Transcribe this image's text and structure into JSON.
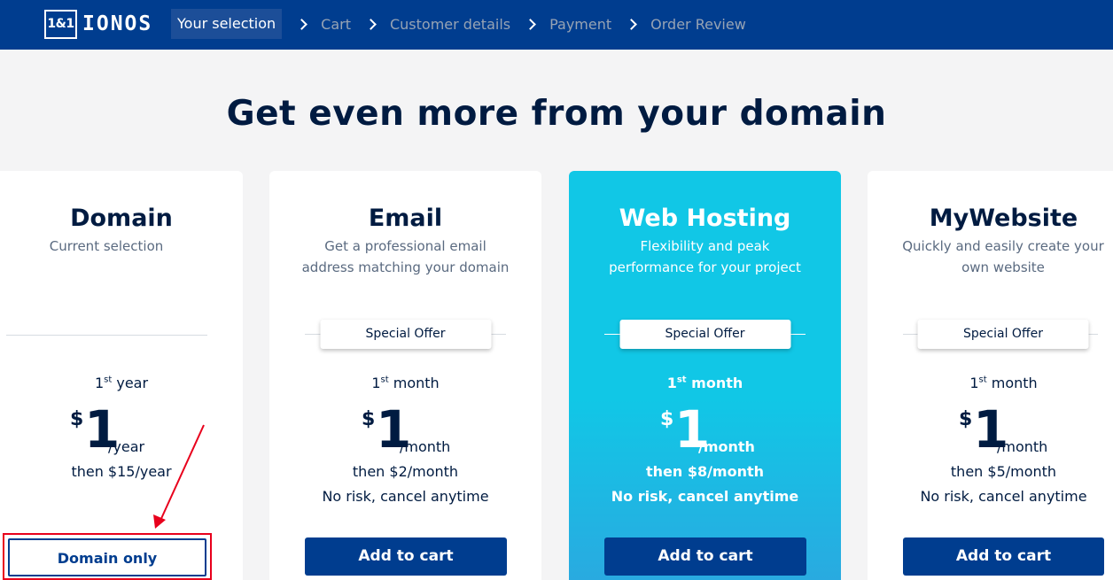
{
  "header": {
    "logo_box": "1&1",
    "logo_word": "IONOS",
    "steps": [
      "Your selection",
      "Cart",
      "Customer details",
      "Payment",
      "Order Review"
    ]
  },
  "headline": "Get even more from your domain",
  "cards": {
    "domain": {
      "title": "Domain",
      "subtitle": "Current selection",
      "period_prefix": "1",
      "period_sup": "st",
      "period_unit": " year",
      "dollar": "$",
      "price": "1",
      "per": "/year",
      "then": "then $15/year",
      "cta": "Domain only"
    },
    "email": {
      "title": "Email",
      "subtitle": "Get a professional email address matching your domain",
      "offer": "Special Offer",
      "period_prefix": "1",
      "period_sup": "st",
      "period_unit": " month",
      "dollar": "$",
      "price": "1",
      "per": "/month",
      "then": "then $2/month",
      "norisk": "No risk, cancel anytime",
      "cta": "Add to cart"
    },
    "hosting": {
      "title": "Web Hosting",
      "subtitle": "Flexibility and peak performance for your project",
      "offer": "Special Offer",
      "period_prefix": "1",
      "period_sup": "st",
      "period_unit": " month",
      "dollar": "$",
      "price": "1",
      "per": "/month",
      "then": "then $8/month",
      "norisk": "No risk, cancel anytime",
      "cta": "Add to cart"
    },
    "website": {
      "title": "MyWebsite",
      "subtitle": "Quickly and easily create your own website",
      "offer": "Special Offer",
      "period_prefix": "1",
      "period_sup": "st",
      "period_unit": " month",
      "dollar": "$",
      "price": "1",
      "per": "/month",
      "then": "then $5/month",
      "norisk": "No risk, cancel anytime",
      "cta": "Add to cart"
    }
  },
  "colors": {
    "brand_blue": "#003d8f",
    "hosting_cyan": "#11c7e6",
    "highlight_red": "#e8001c"
  }
}
